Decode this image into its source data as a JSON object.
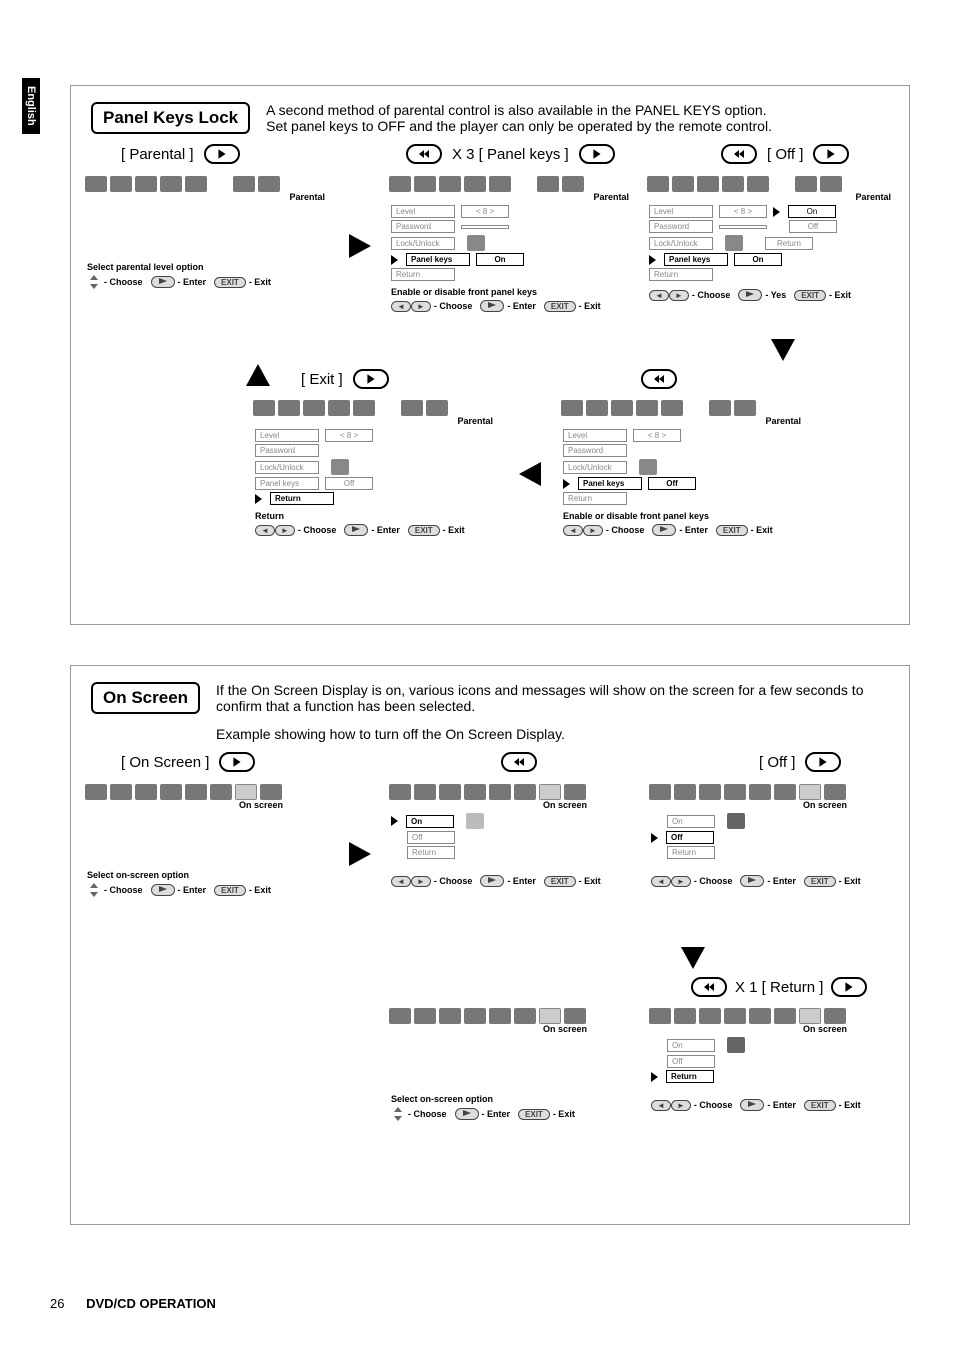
{
  "sideTab": "English",
  "footer": {
    "page": "26",
    "title": "DVD/CD OPERATION"
  },
  "section1": {
    "title": "Panel Keys Lock",
    "desc1": "A second method of parental control is also available in the PANEL KEYS option.",
    "desc2": "Set panel keys to OFF and the player can only be operated by the remote control.",
    "labels": {
      "parental": "[ Parental ]",
      "x3panel": "X 3 [ Panel keys ]",
      "off": "[ Off ]",
      "exit": "[ Exit ]"
    },
    "panelTitle": "Parental",
    "menus": {
      "p1": {
        "hint": "Select parental level option",
        "ctrl": {
          "choose": "- Choose",
          "enter": "- Enter",
          "exit": "- Exit",
          "exitBtn": "EXIT"
        }
      },
      "p2": {
        "rows": {
          "level": "Level",
          "password": "Password",
          "lock": "Lock/Unlock",
          "panelkeys": "Panel keys",
          "return": "Return",
          "val_level": "< 8 >",
          "val_password": "",
          "val_panelkeys": "On"
        },
        "hint": "Enable or disable front panel keys",
        "ctrl": {
          "choose": "- Choose",
          "enter": "- Enter",
          "exit": "- Exit"
        }
      },
      "p3": {
        "rows": {
          "val_panelkeys": "On",
          "val_on": "On",
          "val_off": "Off",
          "val_return": "Return"
        },
        "ctrl": {
          "choose": "- Choose",
          "yes": "- Yes",
          "exit": "- Exit"
        }
      },
      "p5_off": {
        "rows": {
          "val_panelkeys": "Off"
        },
        "hint": "Enable or disable front panel keys",
        "ctrl": {
          "choose": "- Choose",
          "enter": "- Enter",
          "exit": "- Exit"
        }
      },
      "p6_return": {
        "rows": {
          "val_panelkeys": "Off"
        },
        "hint": "Return",
        "ctrl": {
          "choose": "- Choose",
          "enter": "- Enter",
          "exit": "- Exit"
        }
      }
    }
  },
  "section2": {
    "title": "On Screen",
    "desc1": "If the On Screen Display is on, various icons and messages will show on the screen for a few seconds to confirm that a function has been selected.",
    "desc2": "Example showing how to turn off the On Screen Display.",
    "panelTitle": "On screen",
    "labels": {
      "onscreen": "[ On Screen ]",
      "off": "[ Off ]",
      "x1return": "X 1 [ Return ]"
    },
    "menus": {
      "p1": {
        "hint": "Select on-screen option",
        "ctrl": {
          "choose": "- Choose",
          "enter": "- Enter",
          "exit": "- Exit"
        }
      },
      "p2": {
        "rows": {
          "on": "On",
          "off": "Off",
          "return": "Return"
        },
        "ctrl": {
          "choose": "- Choose",
          "enter": "- Enter",
          "exit": "- Exit"
        }
      },
      "p6": {
        "hint": "Select on-screen option",
        "ctrl": {
          "choose": "- Choose",
          "enter": "- Enter",
          "exit": "- Exit"
        }
      }
    }
  }
}
